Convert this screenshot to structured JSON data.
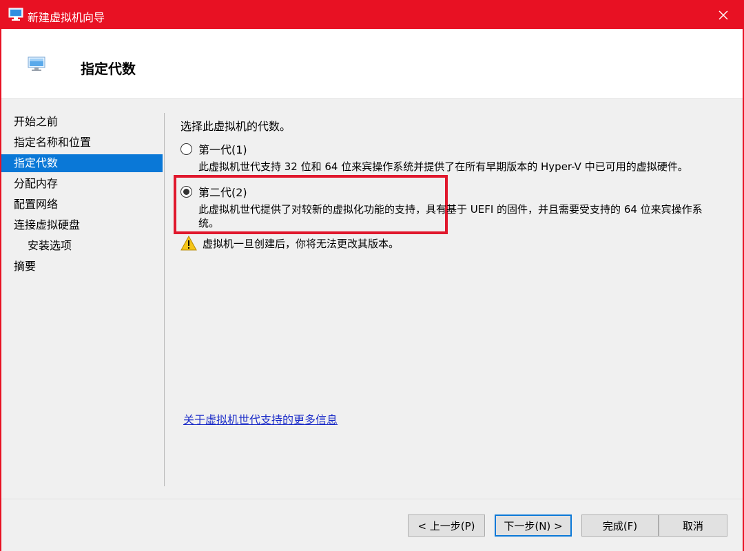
{
  "window": {
    "title": "新建虚拟机向导"
  },
  "header": {
    "title": "指定代数"
  },
  "nav": {
    "items": [
      {
        "label": "开始之前",
        "active": false,
        "indent": false
      },
      {
        "label": "指定名称和位置",
        "active": false,
        "indent": false
      },
      {
        "label": "指定代数",
        "active": true,
        "indent": false
      },
      {
        "label": "分配内存",
        "active": false,
        "indent": false
      },
      {
        "label": "配置网络",
        "active": false,
        "indent": false
      },
      {
        "label": "连接虚拟硬盘",
        "active": false,
        "indent": false
      },
      {
        "label": "安装选项",
        "active": false,
        "indent": true
      },
      {
        "label": "摘要",
        "active": false,
        "indent": false
      }
    ]
  },
  "content": {
    "prompt": "选择此虚拟机的代数。",
    "options": [
      {
        "label": "第一代(1)",
        "checked": false,
        "description": "此虚拟机世代支持 32 位和 64 位来宾操作系统并提供了在所有早期版本的 Hyper-V 中已可用的虚拟硬件。"
      },
      {
        "label": "第二代(2)",
        "checked": true,
        "description": "此虚拟机世代提供了对较新的虚拟化功能的支持，具有基于 UEFI 的固件，并且需要受支持的 64 位来宾操作系统。"
      }
    ],
    "warning": "虚拟机一旦创建后，你将无法更改其版本。",
    "more_info_link": "关于虚拟机世代支持的更多信息"
  },
  "footer": {
    "prev": "< 上一步(P)",
    "next": "下一步(N) >",
    "finish": "完成(F)",
    "cancel": "取消"
  },
  "colors": {
    "accent": "#e81123",
    "selection": "#0a78d7",
    "link": "#1a2bc8",
    "highlight": "#e0182d",
    "warning": "#f5c518"
  }
}
